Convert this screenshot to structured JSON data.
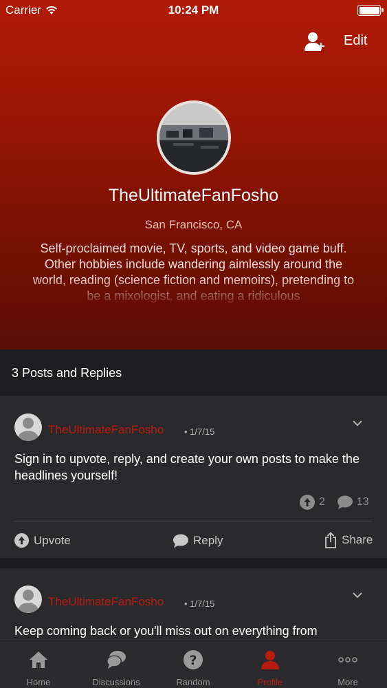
{
  "status_bar": {
    "carrier": "Carrier",
    "time": "10:24 PM"
  },
  "header": {
    "edit_label": "Edit",
    "username": "TheUltimateFanFosho",
    "location": "San Francisco, CA",
    "bio": "Self-proclaimed movie, TV, sports, and video game buff. Other hobbies include wandering aimlessly around the world, reading (science fiction and memoirs), pretending to be a mixologist, and eating a ridiculous"
  },
  "section": {
    "title": "3 Posts and Replies"
  },
  "posts": [
    {
      "author": "TheUltimateFanFosho",
      "date": "• 1/7/15",
      "text": "Sign in to upvote, reply, and create your own posts to make the headlines yourself!",
      "upvotes": "2",
      "comments": "13",
      "actions": {
        "upvote": "Upvote",
        "reply": "Reply",
        "share": "Share"
      }
    },
    {
      "author": "TheUltimateFanFosho",
      "date": "• 1/7/15",
      "text": "Keep coming back or you'll miss out on everything from"
    }
  ],
  "tabs": [
    {
      "label": "Home",
      "icon": "home-icon"
    },
    {
      "label": "Discussions",
      "icon": "discussions-icon"
    },
    {
      "label": "Random",
      "icon": "question-icon"
    },
    {
      "label": "Profile",
      "icon": "profile-icon"
    },
    {
      "label": "More",
      "icon": "more-icon"
    }
  ],
  "colors": {
    "accent": "#b81b0f",
    "header_top": "#b01a06",
    "header_bottom": "#5a0d04",
    "card": "#2a2a2d"
  }
}
